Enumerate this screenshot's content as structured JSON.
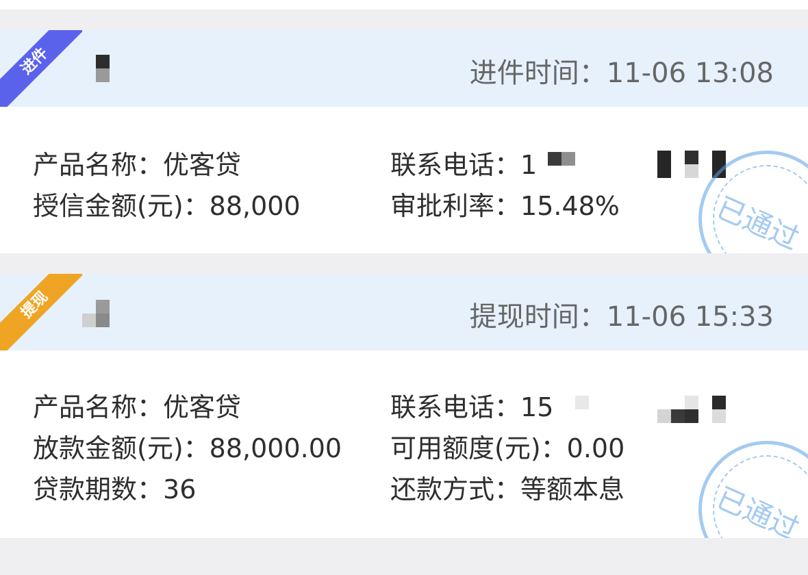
{
  "cards": [
    {
      "badge": "进件",
      "time_label": "进件时间：",
      "time_value": "11-06 13:08",
      "left": [
        {
          "label": "产品名称：",
          "value": "优客贷"
        },
        {
          "label": "授信金额(元)：",
          "value": "88,000"
        }
      ],
      "right": [
        {
          "label": "联系电话：",
          "value": "1"
        },
        {
          "label": "审批利率：",
          "value": "15.48%"
        }
      ],
      "stamp": "已通过"
    },
    {
      "badge": "提现",
      "time_label": "提现时间：",
      "time_value": "11-06 15:33",
      "left": [
        {
          "label": "产品名称：",
          "value": "优客贷"
        },
        {
          "label": "放款金额(元)：",
          "value": "88,000.00"
        },
        {
          "label": "贷款期数：",
          "value": "36"
        }
      ],
      "right": [
        {
          "label": "联系电话：",
          "value": "15"
        },
        {
          "label": "可用额度(元)：",
          "value": "0.00"
        },
        {
          "label": "还款方式：",
          "value": "等额本息"
        }
      ],
      "stamp": "已通过"
    }
  ],
  "colors": {
    "page_bg": "#efeff1",
    "header_bg": "#e6f1fc",
    "badge_blue": "#5a62ec",
    "badge_orange": "#f0a423",
    "stamp": "#5aa0e6"
  }
}
